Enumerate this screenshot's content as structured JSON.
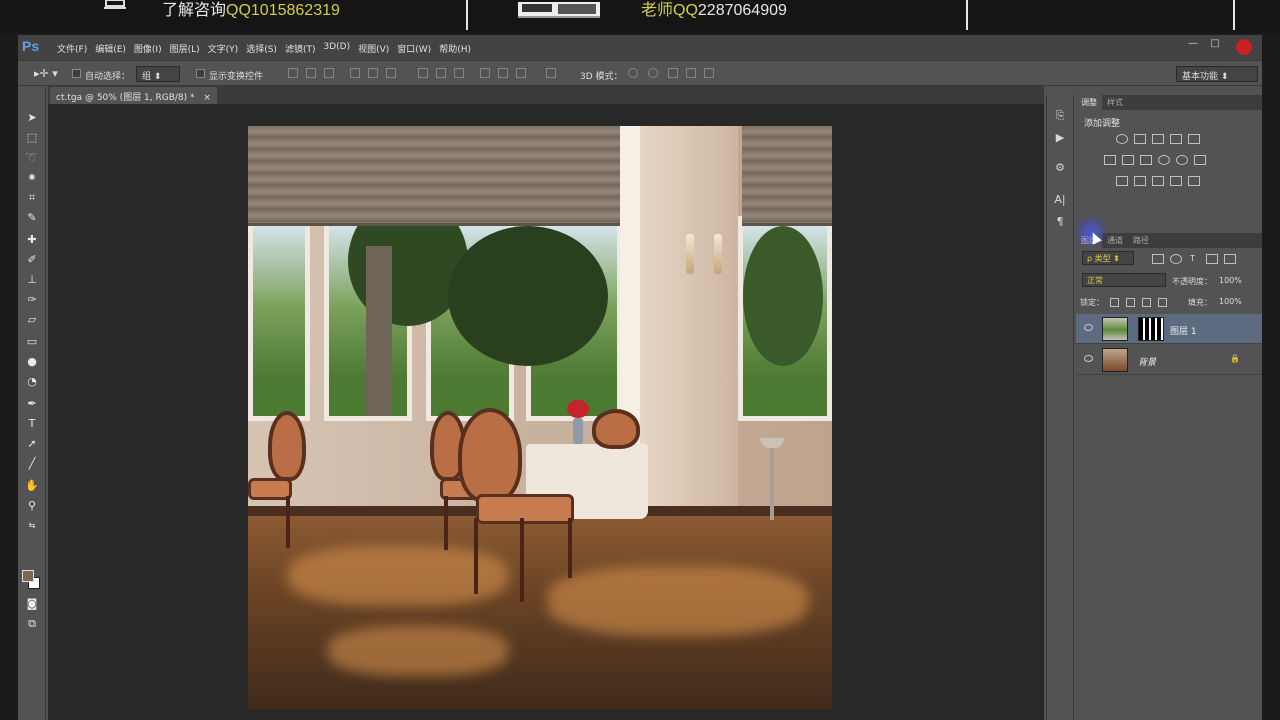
{
  "banner": {
    "left_text": "了解咨询",
    "left_qq_prefix": "QQ",
    "left_qq_number": "1015862319",
    "right_text": "老师",
    "right_qq_prefix": "QQ",
    "right_qq_number": "2287064909"
  },
  "app": {
    "logo": "Ps"
  },
  "menu": [
    "文件(F)",
    "编辑(E)",
    "图像(I)",
    "图层(L)",
    "文字(Y)",
    "选择(S)",
    "滤镜(T)",
    "3D(D)",
    "视图(V)",
    "窗口(W)",
    "帮助(H)"
  ],
  "window_controls": {
    "minimize": "—",
    "restore": "□"
  },
  "options": {
    "auto_select_label": "自动选择：",
    "auto_select_value": "组",
    "show_transform_label": "显示变换控件",
    "mode3d_label": "3D 模式：",
    "workspace": "基本功能"
  },
  "document": {
    "tab_title": "ct.tga @ 50% (图层 1, RGB/8) *",
    "tab_close": "×"
  },
  "panels": {
    "top_tabs": [
      "调整",
      "样式"
    ],
    "adjust_title": "添加调整",
    "layers_tabs": [
      "图层",
      "通道",
      "路径"
    ],
    "filter_kind": "ρ 类型",
    "blend_mode": "正常",
    "opacity_label": "不透明度：",
    "opacity_value": "100%",
    "lock_label": "锁定：",
    "fill_label": "填充：",
    "fill_value": "100%",
    "layers": [
      {
        "name": "图层 1",
        "selected": true
      },
      {
        "name": "背景",
        "selected": false
      }
    ]
  },
  "icons": {
    "move_tool": "move-icon",
    "close": "close-icon"
  },
  "colors": {
    "accent_qq": "#d3ce4a",
    "close_red": "#cc2121",
    "ps_blue": "#5ea0e0"
  }
}
